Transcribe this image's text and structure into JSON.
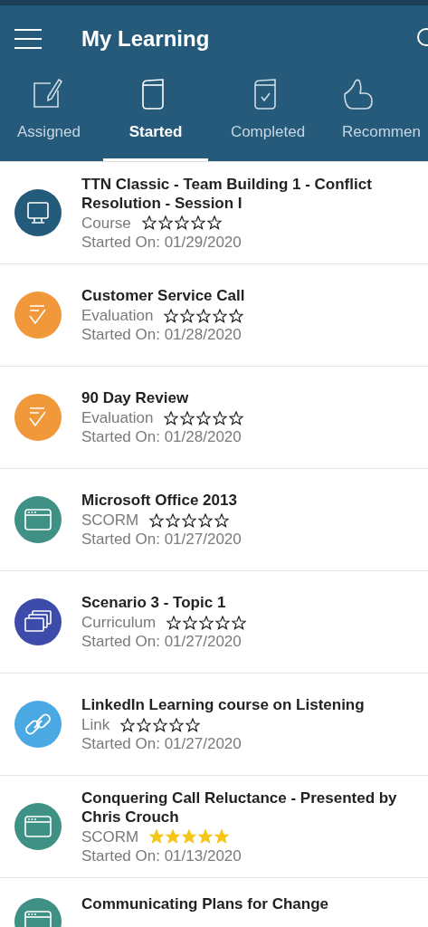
{
  "app_bar": {
    "title": "My Learning"
  },
  "tabs": [
    {
      "label": "Assigned",
      "kind": "assigned",
      "selected": false
    },
    {
      "label": "Started",
      "kind": "started",
      "selected": true
    },
    {
      "label": "Completed",
      "kind": "completed",
      "selected": false
    },
    {
      "label": "Recommen",
      "kind": "recommended",
      "selected": false
    }
  ],
  "items": [
    {
      "title": "TTN Classic - Team Building 1 - Conflict Resolution - Session I",
      "kind": "course",
      "type": "Course",
      "stars": 0,
      "started": "Started On: 01/29/2020"
    },
    {
      "title": "Customer Service Call",
      "kind": "evaluation",
      "type": "Evaluation",
      "stars": 0,
      "started": "Started On: 01/28/2020"
    },
    {
      "title": "90 Day Review",
      "kind": "evaluation",
      "type": "Evaluation",
      "stars": 0,
      "started": "Started On: 01/28/2020"
    },
    {
      "title": "Microsoft Office 2013",
      "kind": "scorm",
      "type": "SCORM",
      "stars": 0,
      "started": "Started On: 01/27/2020"
    },
    {
      "title": "Scenario 3 - Topic 1",
      "kind": "curriculum",
      "type": "Curriculum",
      "stars": 0,
      "started": "Started On: 01/27/2020"
    },
    {
      "title": "LinkedIn Learning course on Listening",
      "kind": "link",
      "type": "Link",
      "stars": 0,
      "started": "Started On: 01/27/2020"
    },
    {
      "title": "Conquering Call Reluctance - Presented by Chris Crouch",
      "kind": "scorm",
      "type": "SCORM",
      "stars": 5,
      "started": "Started On: 01/13/2020"
    },
    {
      "title": "Communicating Plans for Change",
      "kind": "scorm"
    }
  ]
}
